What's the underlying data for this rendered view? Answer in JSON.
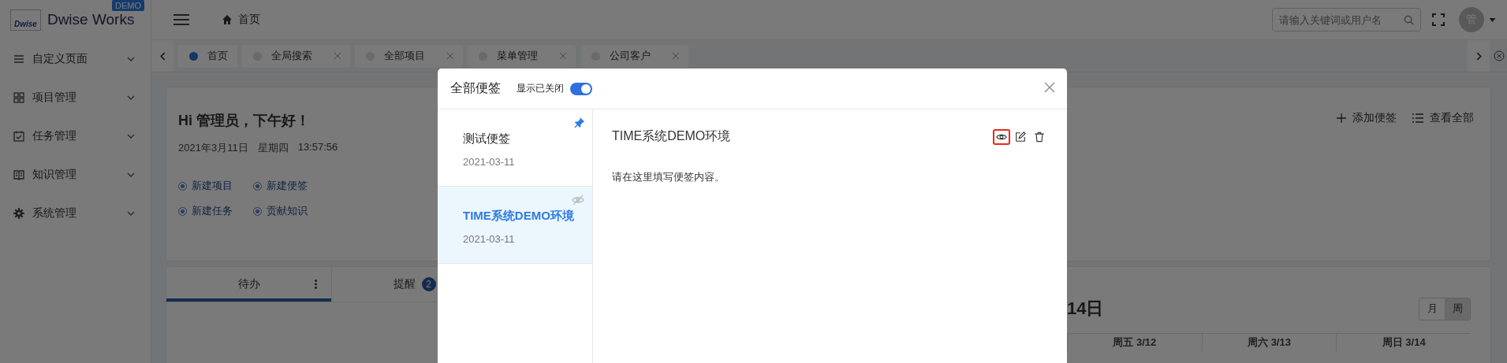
{
  "brand": {
    "logo": "Dwise",
    "name": "Dwise Works",
    "badge": "DEMO"
  },
  "sidebar": {
    "items": [
      {
        "label": "自定义页面",
        "kind": "lines"
      },
      {
        "label": "项目管理",
        "kind": "grid"
      },
      {
        "label": "任务管理",
        "kind": "calendar"
      },
      {
        "label": "知识管理",
        "kind": "book"
      },
      {
        "label": "系统管理",
        "kind": "gear"
      }
    ]
  },
  "header": {
    "breadcrumb": "首页",
    "search": {
      "placeholder": "请输入关键词或用户名"
    },
    "avatar": "管"
  },
  "tabs": [
    {
      "label": "首页",
      "selected": true,
      "closable": false
    },
    {
      "label": "全局搜索",
      "selected": false,
      "closable": true
    },
    {
      "label": "全部项目",
      "selected": false,
      "closable": true
    },
    {
      "label": "菜单管理",
      "selected": false,
      "closable": true
    },
    {
      "label": "公司客户",
      "selected": false,
      "closable": true
    }
  ],
  "greeting": {
    "title": "Hi 管理员，下午好！",
    "date": "2021年3月11日",
    "weekday": "星期四",
    "time": "13:57:56",
    "actions": [
      "新建项目",
      "新建便签",
      "新建任务",
      "贡献知识"
    ],
    "links": [
      {
        "label": "添加便签",
        "kind": "plus"
      },
      {
        "label": "查看全部",
        "kind": "list"
      }
    ]
  },
  "panel": {
    "tabs": [
      {
        "label": "待办",
        "selected": true
      },
      {
        "label": "提醒",
        "selected": false,
        "badge": "2"
      }
    ]
  },
  "calendar": {
    "title": "14日",
    "views": [
      {
        "label": "月",
        "selected": false
      },
      {
        "label": "周",
        "selected": true
      }
    ],
    "columns": [
      "周五 3/12",
      "周六 3/13",
      "周日 3/14"
    ]
  },
  "modal": {
    "title": "全部便签",
    "toggle": {
      "label": "显示已关闭",
      "on": true
    },
    "notes": [
      {
        "title": "测试便签",
        "date": "2021-03-11",
        "pinned": true,
        "closed": false,
        "selected": false
      },
      {
        "title": "TIME系统DEMO环境",
        "date": "2021-03-11",
        "pinned": false,
        "closed": true,
        "selected": true
      }
    ],
    "detail": {
      "title": "TIME系统DEMO环境",
      "body": "请在这里填写便签内容。",
      "actions": [
        {
          "kind": "view",
          "highlighted": true
        },
        {
          "kind": "edit",
          "highlighted": false
        },
        {
          "kind": "delete",
          "highlighted": false
        }
      ]
    }
  }
}
